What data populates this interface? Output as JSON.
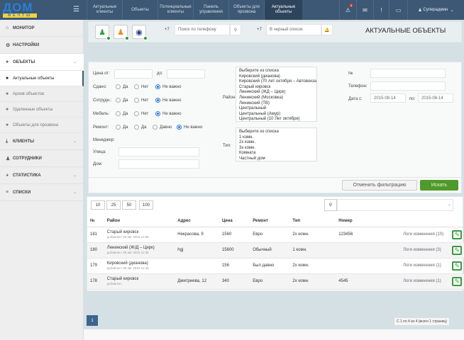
{
  "logo": {
    "text": "ДОМ",
    "sub": "МЕЧТЫ"
  },
  "nav": [
    {
      "label": "Актуальные клиенты"
    },
    {
      "label": "Объекты"
    },
    {
      "label": "Потенциальные клиенты"
    },
    {
      "label": "Панель управления"
    },
    {
      "label": "Объекты для прозвона"
    },
    {
      "label": "Актуальные объекты"
    }
  ],
  "header": {
    "alert_count": "8",
    "user": "Суперадмин"
  },
  "sidebar": {
    "items": [
      {
        "label": "МОНИТОР"
      },
      {
        "label": "НАСТРОЙКИ"
      },
      {
        "label": "ОБЪЕКТЫ"
      },
      {
        "label": "КЛИЕНТЫ"
      },
      {
        "label": "СОТРУДНИКИ"
      },
      {
        "label": "СТАТИСТИКА"
      },
      {
        "label": "СПИСКИ"
      }
    ],
    "sub": [
      {
        "label": "Актуальные объекты"
      },
      {
        "label": "Архив объектов"
      },
      {
        "label": "Удаленные объекты"
      },
      {
        "label": "Объекты для прозвона"
      }
    ]
  },
  "toolbar": {
    "prefix1": "+7",
    "phone_placeholder": "Поиск по телефону",
    "prefix2": "+7",
    "blacklist_placeholder": "В черный список",
    "title": "АКТУАЛЬНЫЕ ОБЪЕКТЫ"
  },
  "filter": {
    "price_from": "Цена от:",
    "price_to": "до:",
    "rented": "Сдано:",
    "staff": "Сотрудн.:",
    "furniture": "Мебель:",
    "repair": "Ремонт:",
    "yes": "Да",
    "no": "Нет",
    "any": "Не важно",
    "repair_opt2": "Да",
    "repair_opt3": "Давно",
    "manager": "Менеджер:",
    "street": "Улица:",
    "house": "Дом:",
    "district_label": "Район:",
    "districts": [
      "Выберите из списка",
      "Кировский (дианова)",
      "Кировский (70 лет октября – Автовокзал)",
      "Старый кировск",
      "Ленинский (ЖД – Цирк)",
      "Ленинский (Московка)",
      "Ленинский (ТВ)",
      "Центральный",
      "Центральный (Амур)",
      "Центральный (10 Лет октября)"
    ],
    "type_label": "Тип:",
    "types": [
      "Выберите из списка",
      "1 комн.",
      "2х комн.",
      "3х комн.",
      "Комната",
      "Частный дом"
    ],
    "number_label": "№",
    "phone_label": "Телефон:",
    "date_from_label": "Дата с:",
    "date_from": "2015-08-14",
    "date_to_label": "по:",
    "date_to": "2015-08-14",
    "reset": "Отменить фильтрацию",
    "search": "Искать"
  },
  "page_sizes": [
    "10",
    "25",
    "50",
    "100"
  ],
  "table": {
    "headers": [
      "№",
      "Район",
      "Адрес",
      "Цена",
      "Ремонт",
      "Тип",
      "Номер"
    ],
    "rows": [
      {
        "id": "181",
        "district": "Старый кировск",
        "added": "добавлен: 06 авг 2015 11:56",
        "address": "Некрасова, 9",
        "price": "1560",
        "repair": "Евро",
        "type": "2х комн.",
        "number": "123456",
        "log": "Логи изменения (10)"
      },
      {
        "id": "180",
        "district": "Ленинский (Ж/Д – Цирк)",
        "added": "добавлен: 06 авг 2015 11:46",
        "address": "hgj",
        "price": "15600",
        "repair": "Обычный",
        "type": "1 комн.",
        "number": "",
        "log": "Логи изменения (3)"
      },
      {
        "id": "179",
        "district": "Кировский (дианова)",
        "added": "добавлен: 06 авг 2015 11:45",
        "address": "",
        "price": "156",
        "repair": "Был давно",
        "type": "2х комн.",
        "number": "",
        "log": "Логи изменения (1)"
      },
      {
        "id": "178",
        "district": "Старый кировск",
        "added": "добавлен:",
        "address": "Дмитриева, 12",
        "price": "340",
        "repair": "Евро",
        "type": "2х комн.",
        "number": "4545",
        "log": "Логи изменения (1)"
      }
    ]
  },
  "pagination": {
    "current": "1",
    "info": "С 1 по 4 из 4 (всего 1 страниц)"
  }
}
